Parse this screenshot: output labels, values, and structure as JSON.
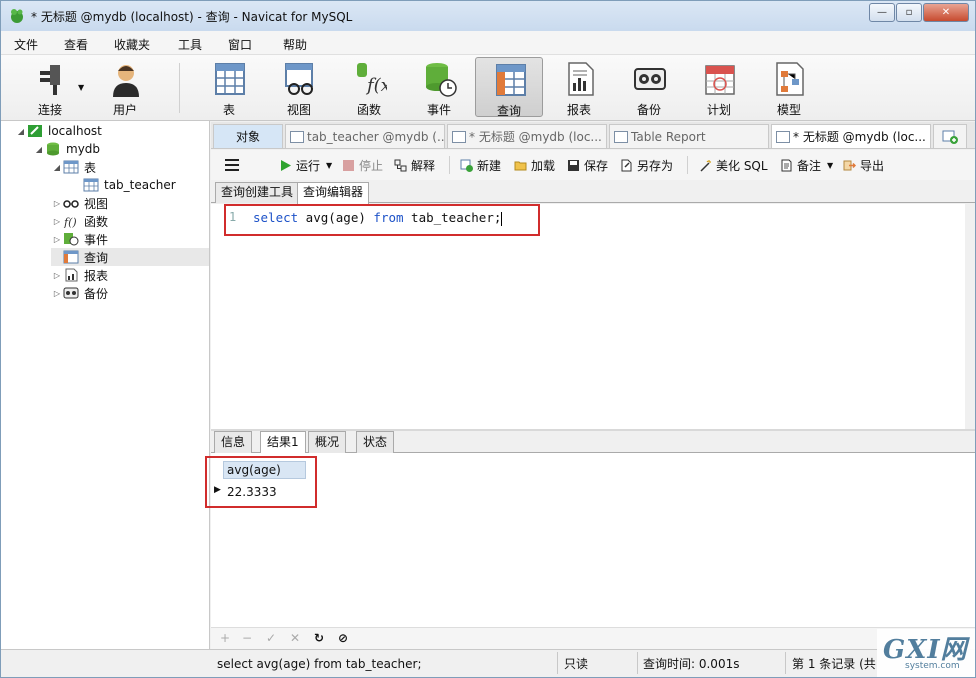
{
  "window": {
    "title": "* 无标题 @mydb (localhost) - 查询 - Navicat for MySQL",
    "minimize_glyph": "—",
    "restore_glyph": "▫",
    "close_glyph": "✕"
  },
  "menu": [
    "文件",
    "查看",
    "收藏夹",
    "工具",
    "窗口",
    "帮助"
  ],
  "toolbar": {
    "connect": "连接",
    "user": "用户",
    "table": "表",
    "view": "视图",
    "function": "函数",
    "event": "事件",
    "query": "查询",
    "report": "报表",
    "backup": "备份",
    "schedule": "计划",
    "model": "模型"
  },
  "tree": {
    "connection": "localhost",
    "database": "mydb",
    "tables": "表",
    "table_name": "tab_teacher",
    "views": "视图",
    "functions": "函数",
    "events": "事件",
    "queries": "查询",
    "reports": "报表",
    "backups": "备份"
  },
  "tabs": {
    "objects": "对象",
    "tab1": "tab_teacher @mydb (...",
    "tab2": "* 无标题 @mydb (loc...",
    "tab3": "Table Report",
    "tab4": "* 无标题 @mydb (loc..."
  },
  "query_toolbar": {
    "run": "运行",
    "stop": "停止",
    "explain": "解释",
    "new": "新建",
    "load": "加载",
    "save": "保存",
    "save_as": "另存为",
    "beautify": "美化 SQL",
    "comment": "备注",
    "export": "导出"
  },
  "editor_tabs": {
    "builder": "查询创建工具",
    "editor": "查询编辑器"
  },
  "editor": {
    "line_number": "1",
    "kw_select": "select",
    "expr": " avg(age) ",
    "kw_from": "from",
    "rest": " tab_teacher;"
  },
  "result_tabs": {
    "info": "信息",
    "result1": "结果1",
    "profile": "概况",
    "status": "状态"
  },
  "result": {
    "column": "avg(age)",
    "value": "22.3333"
  },
  "grid_tools": {
    "add": "+",
    "delete": "−",
    "apply": "✓",
    "discard": "✕",
    "refresh": "↻",
    "stop": "⊘"
  },
  "status": {
    "sql": "select avg(age) from tab_teacher;",
    "mode": "只读",
    "time": "查询时间: 0.001s",
    "records": "第 1 条记录 (共"
  },
  "watermark": {
    "main": "GXI网",
    "sub": "system.com"
  },
  "colors": {
    "highlight_box": "#d12c2c",
    "keyword": "#1d52c8",
    "title_bar": "#c9daee"
  }
}
